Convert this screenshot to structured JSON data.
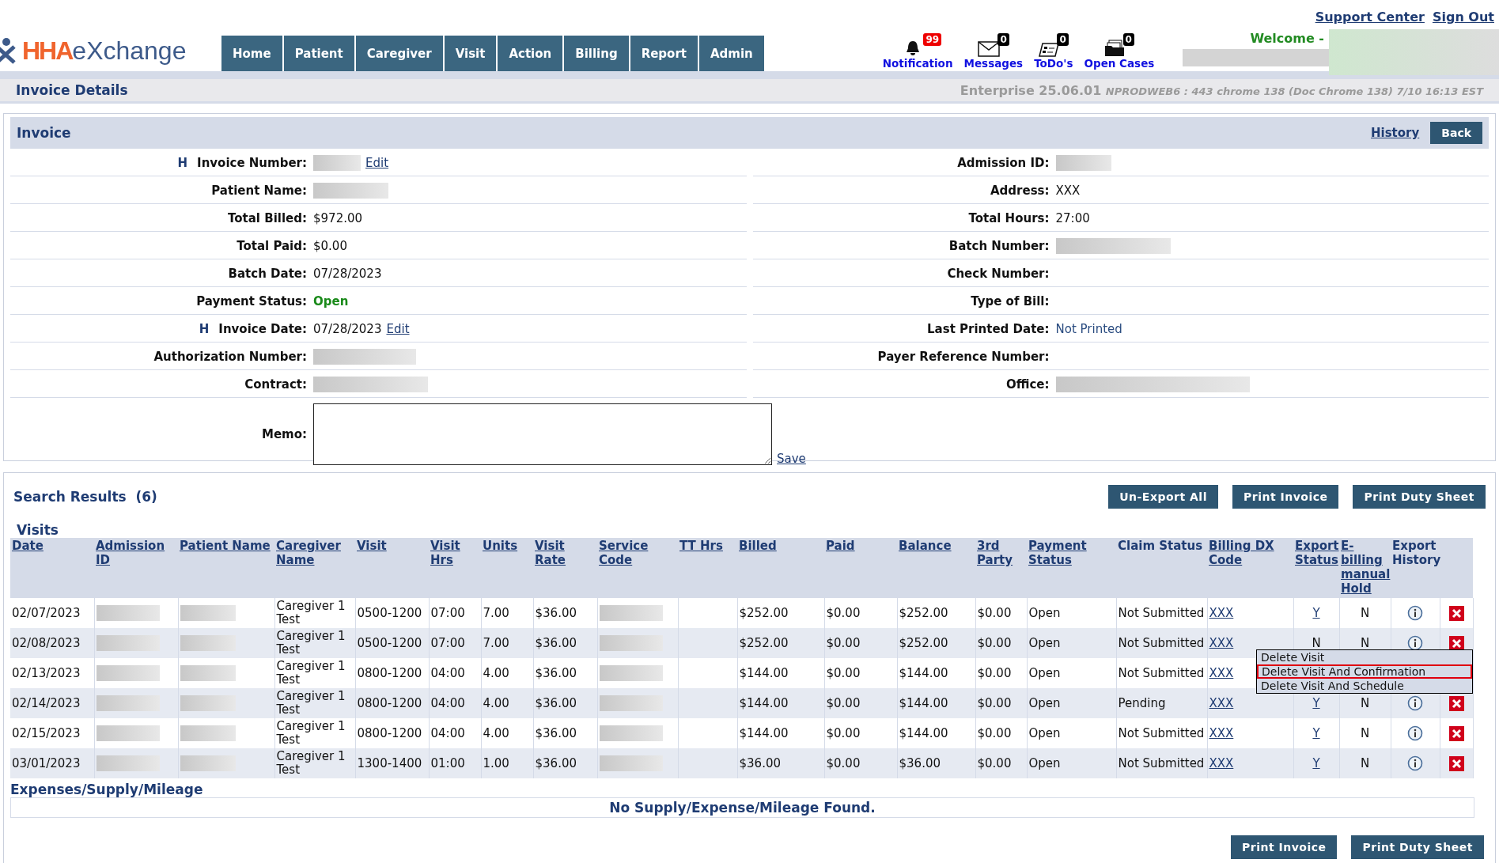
{
  "header": {
    "logo": {
      "prefix": "HHA",
      "suffix": "eXchange"
    },
    "nav": [
      {
        "label": "Home"
      },
      {
        "label": "Patient"
      },
      {
        "label": "Caregiver"
      },
      {
        "label": "Visit"
      },
      {
        "label": "Action"
      },
      {
        "label": "Billing"
      },
      {
        "label": "Report"
      },
      {
        "label": "Admin"
      }
    ],
    "alerts": [
      {
        "kind": "bell",
        "label": "Notification",
        "count": "99"
      },
      {
        "kind": "envelope",
        "label": "Messages",
        "count": "0"
      },
      {
        "kind": "todo",
        "label": "ToDo's",
        "count": "0"
      },
      {
        "kind": "folder",
        "label": "Open Cases",
        "count": "0"
      }
    ],
    "links": [
      "Support Center",
      "Sign Out"
    ],
    "welcome": "Welcome -"
  },
  "page_title": "Invoice Details",
  "version": "Enterprise 25.06.01",
  "build_info": "NPRODWEB6 : 443 chrome 138 (Doc Chrome 138) 7/10 16:13 EST",
  "invoice": {
    "title": "Invoice",
    "history": "History",
    "back": "Back",
    "left": [
      {
        "marker": "H",
        "label": "Invoice Number:",
        "kind": "redacted",
        "action": "Edit"
      },
      {
        "label": "Patient Name:",
        "kind": "redacted"
      },
      {
        "label": "Total Billed:",
        "kind": "text",
        "value": "$972.00"
      },
      {
        "label": "Total Paid:",
        "kind": "text",
        "value": "$0.00"
      },
      {
        "label": "Batch Date:",
        "kind": "text",
        "value": "07/28/2023"
      },
      {
        "label": "Payment Status:",
        "kind": "status",
        "value": "Open"
      },
      {
        "marker": "H",
        "label": "Invoice Date:",
        "kind": "text",
        "value": "07/28/2023",
        "action": "Edit"
      },
      {
        "label": "Authorization Number:",
        "kind": "redacted"
      },
      {
        "label": "Contract:",
        "kind": "redacted"
      }
    ],
    "right": [
      {
        "label": "Admission ID:",
        "kind": "redacted"
      },
      {
        "label": "Address:",
        "kind": "text",
        "value": "XXX"
      },
      {
        "label": "Total Hours:",
        "kind": "text",
        "value": "27:00"
      },
      {
        "label": "Batch Number:",
        "kind": "redacted"
      },
      {
        "label": "Check Number:",
        "kind": "empty"
      },
      {
        "label": "Type of Bill:",
        "kind": "empty"
      },
      {
        "label": "Last Printed Date:",
        "kind": "muted",
        "value": "Not Printed"
      },
      {
        "label": "Payer Reference Number:",
        "kind": "empty"
      },
      {
        "label": "Office:",
        "kind": "redacted"
      }
    ],
    "memo": {
      "label": "Memo:",
      "save": "Save"
    }
  },
  "results": {
    "title": "Search Results",
    "count": "(6)",
    "buttons": [
      "Un-Export All",
      "Print Invoice",
      "Print Duty Sheet"
    ],
    "visits_title": "Visits",
    "columns": [
      {
        "label": "Date",
        "link": true
      },
      {
        "label": "Admission ID",
        "link": true
      },
      {
        "label": "Patient Name",
        "link": true
      },
      {
        "label": "Caregiver Name",
        "link": true
      },
      {
        "label": "Visit",
        "link": true
      },
      {
        "label": "Visit Hrs",
        "link": true
      },
      {
        "label": "Units",
        "link": true
      },
      {
        "label": "Visit Rate",
        "link": true
      },
      {
        "label": "Service Code",
        "link": true
      },
      {
        "label": "TT Hrs",
        "link": true
      },
      {
        "label": "Billed",
        "link": true
      },
      {
        "label": "Paid",
        "link": true
      },
      {
        "label": "Balance",
        "link": true
      },
      {
        "label": "3rd Party",
        "link": true
      },
      {
        "label": "Payment Status",
        "link": true
      },
      {
        "label": "Claim Status",
        "link": false
      },
      {
        "label": "Billing DX Code",
        "link": true
      },
      {
        "label": "Export Status",
        "link": true
      },
      {
        "label": "E-billing manual Hold",
        "link": true
      },
      {
        "label": "Export History",
        "link": false
      }
    ],
    "rows": [
      {
        "date": "02/07/2023",
        "caregiver": "Caregiver 1 Test",
        "visit": "0500-1200",
        "visit_hrs": "07:00",
        "units": "7.00",
        "rate": "$36.00",
        "billed": "$252.00",
        "paid": "$0.00",
        "balance": "$252.00",
        "third_party": "$0.00",
        "payment_status": "Open",
        "claim_status": "Not Submitted",
        "dx": "XXX",
        "export_status": "Y",
        "export_linked": true,
        "hold": "N"
      },
      {
        "date": "02/08/2023",
        "caregiver": "Caregiver 1 Test",
        "visit": "0500-1200",
        "visit_hrs": "07:00",
        "units": "7.00",
        "rate": "$36.00",
        "billed": "$252.00",
        "paid": "$0.00",
        "balance": "$252.00",
        "third_party": "$0.00",
        "payment_status": "Open",
        "claim_status": "Not Submitted",
        "dx": "XXX",
        "export_status": "N",
        "export_linked": false,
        "hold": "N"
      },
      {
        "date": "02/13/2023",
        "caregiver": "Caregiver 1 Test",
        "visit": "0800-1200",
        "visit_hrs": "04:00",
        "units": "4.00",
        "rate": "$36.00",
        "billed": "$144.00",
        "paid": "$0.00",
        "balance": "$144.00",
        "third_party": "$0.00",
        "payment_status": "Open",
        "claim_status": "Not Submitted",
        "dx": "XXX"
      },
      {
        "date": "02/14/2023",
        "caregiver": "Caregiver 1 Test",
        "visit": "0800-1200",
        "visit_hrs": "04:00",
        "units": "4.00",
        "rate": "$36.00",
        "billed": "$144.00",
        "paid": "$0.00",
        "balance": "$144.00",
        "third_party": "$0.00",
        "payment_status": "Open",
        "claim_status": "Pending",
        "dx": "XXX",
        "export_status": "Y",
        "export_linked": true,
        "hold": "N"
      },
      {
        "date": "02/15/2023",
        "caregiver": "Caregiver 1 Test",
        "visit": "0800-1200",
        "visit_hrs": "04:00",
        "units": "4.00",
        "rate": "$36.00",
        "billed": "$144.00",
        "paid": "$0.00",
        "balance": "$144.00",
        "third_party": "$0.00",
        "payment_status": "Open",
        "claim_status": "Not Submitted",
        "dx": "XXX",
        "export_status": "Y",
        "export_linked": true,
        "hold": "N"
      },
      {
        "date": "03/01/2023",
        "caregiver": "Caregiver 1 Test",
        "visit": "1300-1400",
        "visit_hrs": "01:00",
        "units": "1.00",
        "rate": "$36.00",
        "billed": "$36.00",
        "paid": "$0.00",
        "balance": "$36.00",
        "third_party": "$0.00",
        "payment_status": "Open",
        "claim_status": "Not Submitted",
        "dx": "XXX",
        "export_status": "Y",
        "export_linked": true,
        "hold": "N"
      }
    ],
    "context_menu": [
      {
        "label": "Delete Visit",
        "selected": false
      },
      {
        "label": "Delete Visit And Confirmation",
        "selected": true
      },
      {
        "label": "Delete Visit And Schedule",
        "selected": false
      }
    ],
    "expenses_title": "Expenses/Supply/Mileage",
    "expenses_empty": "No Supply/Expense/Mileage Found.",
    "bottom_buttons": [
      "Print Invoice",
      "Print Duty Sheet"
    ]
  }
}
